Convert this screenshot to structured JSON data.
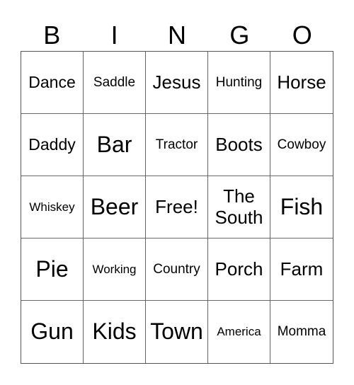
{
  "header": [
    "B",
    "I",
    "N",
    "G",
    "O"
  ],
  "rows": [
    [
      {
        "text": "Dance",
        "size": "md"
      },
      {
        "text": "Saddle",
        "size": "sm"
      },
      {
        "text": "Jesus",
        "size": "lg"
      },
      {
        "text": "Hunting",
        "size": "sm"
      },
      {
        "text": "Horse",
        "size": "lg"
      }
    ],
    [
      {
        "text": "Daddy",
        "size": "md"
      },
      {
        "text": "Bar",
        "size": "xl"
      },
      {
        "text": "Tractor",
        "size": "sm"
      },
      {
        "text": "Boots",
        "size": "lg"
      },
      {
        "text": "Cowboy",
        "size": "sm"
      }
    ],
    [
      {
        "text": "Whiskey",
        "size": "xs"
      },
      {
        "text": "Beer",
        "size": "xl"
      },
      {
        "text": "Free!",
        "size": "lg"
      },
      {
        "text": "The South",
        "size": "lg"
      },
      {
        "text": "Fish",
        "size": "xl"
      }
    ],
    [
      {
        "text": "Pie",
        "size": "xl"
      },
      {
        "text": "Working",
        "size": "xs"
      },
      {
        "text": "Country",
        "size": "sm"
      },
      {
        "text": "Porch",
        "size": "lg"
      },
      {
        "text": "Farm",
        "size": "lg"
      }
    ],
    [
      {
        "text": "Gun",
        "size": "xl"
      },
      {
        "text": "Kids",
        "size": "xl"
      },
      {
        "text": "Town",
        "size": "xl"
      },
      {
        "text": "America",
        "size": "xs"
      },
      {
        "text": "Momma",
        "size": "sm"
      }
    ]
  ]
}
